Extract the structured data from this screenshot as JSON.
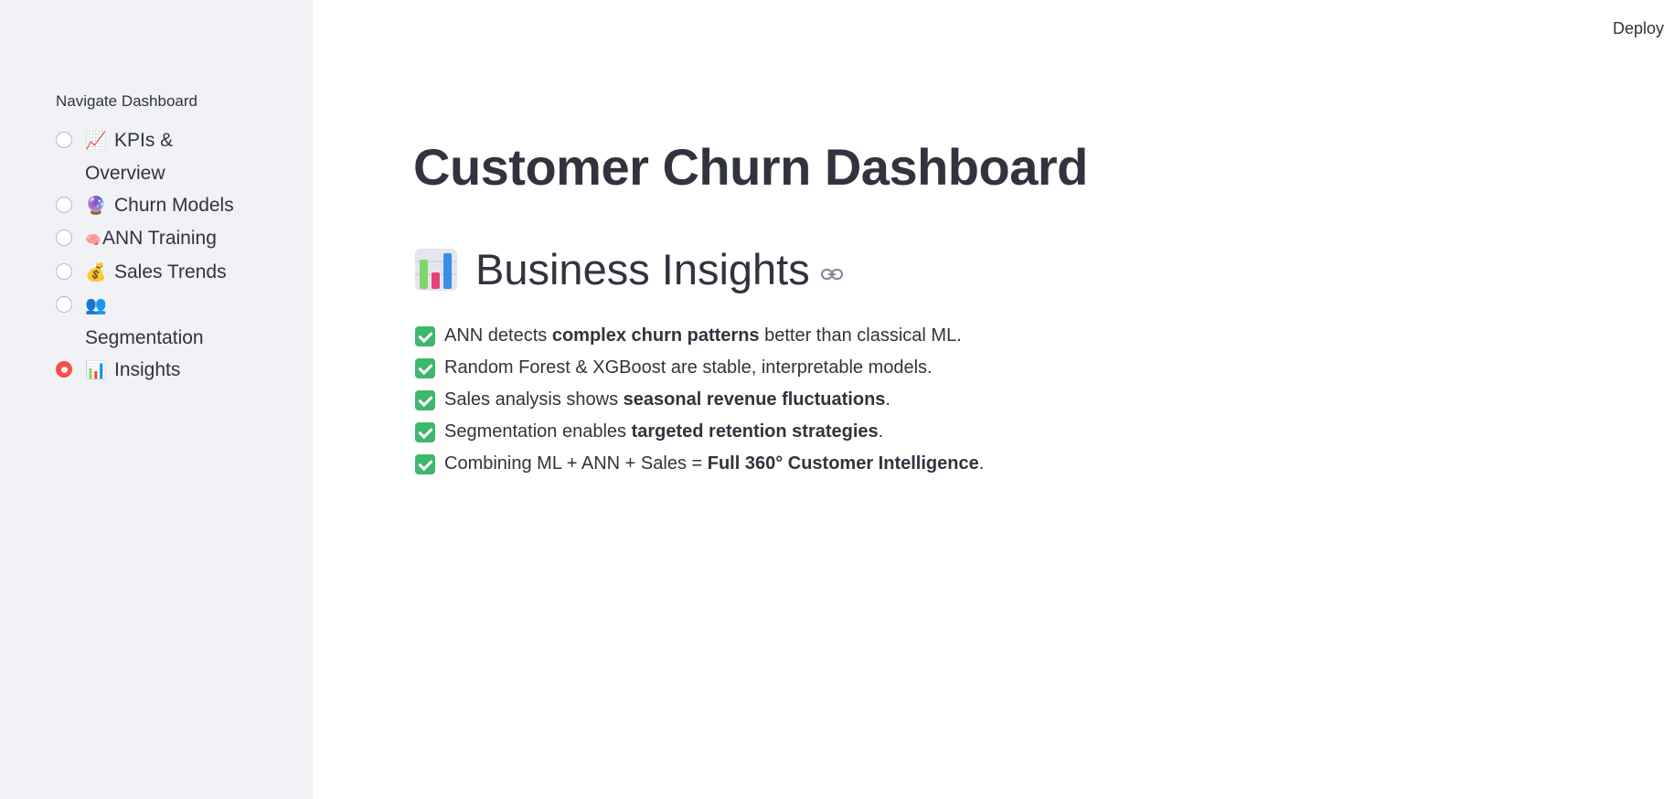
{
  "header": {
    "deploy_label": "Deploy"
  },
  "sidebar": {
    "nav_label": "Navigate Dashboard",
    "items": [
      {
        "icon": "📈",
        "icon_name": "chart-increasing-icon",
        "label": "KPIs & Overview",
        "selected": false
      },
      {
        "icon": "🔮",
        "icon_name": "crystal-ball-icon",
        "label": "Churn Models",
        "selected": false
      },
      {
        "icon": "🧠",
        "icon_name": "brain-icon",
        "label": "ANN Training",
        "selected": false
      },
      {
        "icon": "💰",
        "icon_name": "money-bag-icon",
        "label": "Sales Trends",
        "selected": false
      },
      {
        "icon": "👥",
        "icon_name": "people-icon",
        "label": "Segmentation",
        "selected": false
      },
      {
        "icon": "📊",
        "icon_name": "bar-chart-icon",
        "label": "Insights",
        "selected": true
      }
    ],
    "accent_color": "#ff4b4b"
  },
  "main": {
    "title": "Customer Churn Dashboard",
    "section": {
      "icon_name": "bar-chart-icon",
      "title": "Business Insights"
    },
    "insights": [
      {
        "before": "ANN detects ",
        "bold": "complex churn patterns",
        "after": " better than classical ML."
      },
      {
        "before": "Random Forest & XGBoost are stable, interpretable models.",
        "bold": "",
        "after": ""
      },
      {
        "before": "Sales analysis shows ",
        "bold": "seasonal revenue fluctuations",
        "after": "."
      },
      {
        "before": "Segmentation enables ",
        "bold": "targeted retention strategies",
        "after": "."
      },
      {
        "before": "Combining ML + ANN + Sales = ",
        "bold": "Full 360° Customer Intelligence",
        "after": "."
      }
    ],
    "check_color": "#3fb86b"
  }
}
